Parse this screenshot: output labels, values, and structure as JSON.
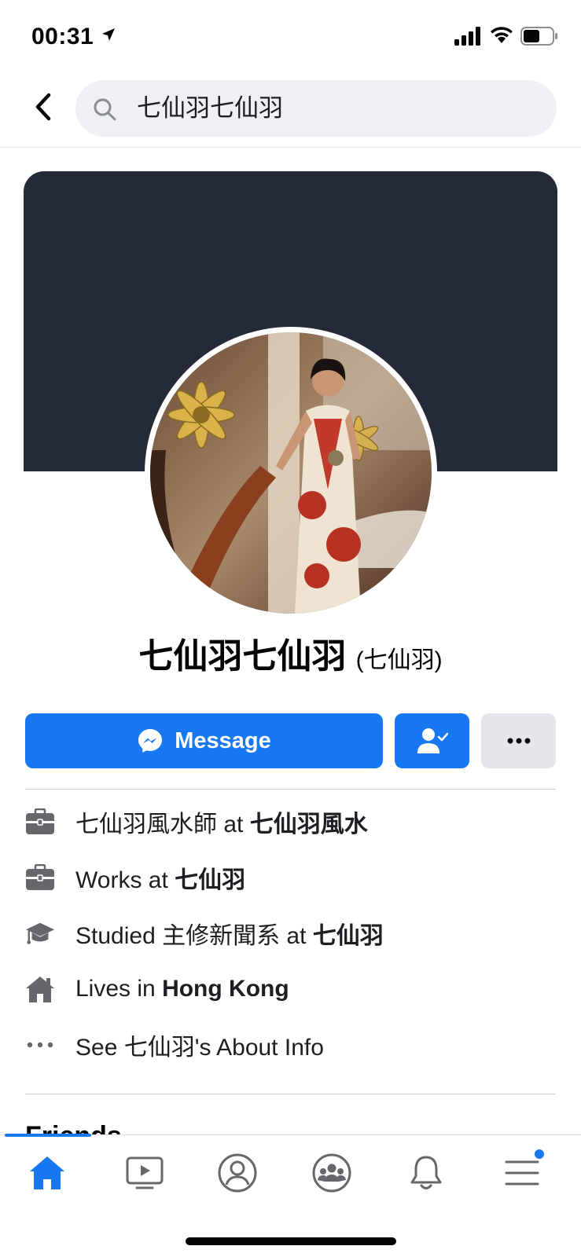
{
  "status_bar": {
    "time": "00:31"
  },
  "search": {
    "query": "七仙羽七仙羽"
  },
  "profile": {
    "name": "七仙羽七仙羽",
    "alt_name": "(七仙羽)"
  },
  "actions": {
    "message_label": "Message"
  },
  "info": [
    {
      "icon": "briefcase-icon",
      "prefix": "七仙羽風水師 at ",
      "bold": "七仙羽風水"
    },
    {
      "icon": "briefcase-icon",
      "prefix": "Works at ",
      "bold": "七仙羽"
    },
    {
      "icon": "graduation-cap-icon",
      "prefix": "Studied 主修新聞系 at ",
      "bold": "七仙羽"
    },
    {
      "icon": "house-icon",
      "prefix": "Lives in ",
      "bold": "Hong Kong"
    },
    {
      "icon": "more-dots-icon",
      "prefix": "See 七仙羽's About Info",
      "bold": ""
    }
  ],
  "friends_heading": "Friends",
  "colors": {
    "accent": "#1877f2",
    "cover": "#252a38",
    "icon_gray": "#65676b"
  },
  "bottom_nav": [
    "home-icon",
    "watch-icon",
    "profile-icon",
    "groups-icon",
    "bell-icon",
    "menu-icon"
  ]
}
